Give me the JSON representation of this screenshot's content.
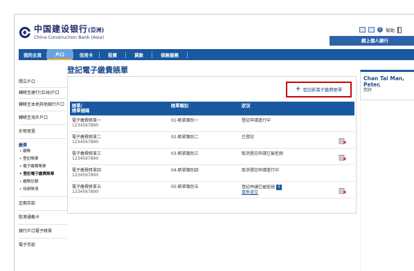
{
  "brand": {
    "name_zh": "中国建设银行",
    "name_zh_suffix": "(亞洲)",
    "name_en": "China Construction Bank (Asia)"
  },
  "utility": {
    "help_label": "幫助",
    "colors": {
      "accent": "#1a58a1",
      "highlight": "#c00000"
    }
  },
  "personal_banking_label": "網上個人銀行",
  "nav": [
    {
      "label": "我的主頁"
    },
    {
      "label": "戶口"
    },
    {
      "label": "信用卡"
    },
    {
      "label": "投資"
    },
    {
      "label": "貸款"
    },
    {
      "label": "保險服務"
    }
  ],
  "sidebar": {
    "items_top": [
      {
        "label": "開立戶口"
      },
      {
        "label": "轉賬至建行(亞洲)戶口"
      },
      {
        "label": "轉賬至本地其他銀行戶口"
      },
      {
        "label": "轉賬至海外戶口"
      },
      {
        "label": "外幣買賣"
      }
    ],
    "section_title": "繳費",
    "sub_items": [
      {
        "label": "繳賬"
      },
      {
        "label": "登記賬單"
      },
      {
        "label": "電子繳費賬單"
      },
      {
        "label": "登記電子繳費賬單"
      },
      {
        "label": "繳賬記錄"
      },
      {
        "label": "待辦賬項"
      }
    ],
    "items_bottom": [
      {
        "label": "定期存款"
      },
      {
        "label": "陸港通載卡"
      },
      {
        "label": "銀行戶口電子賬單"
      },
      {
        "label": "電子存款"
      }
    ]
  },
  "page_title": "登記電子繳費賬單",
  "add_button_label": "登記新電子繳費賬單",
  "table": {
    "headers": [
      "賬單/\n賬單號碼",
      "賬單類別",
      "狀況"
    ],
    "rows": [
      {
        "name": "電子繳費賬單一",
        "number": "1234567890",
        "category": "01-賬單類別一",
        "status": "登記申請進行中",
        "has_delete": false,
        "has_info": false,
        "link": ""
      },
      {
        "name": "電子繳費賬單二",
        "number": "1234567890",
        "category": "02-賬單類別二",
        "status": "已登記",
        "has_delete": true,
        "has_info": false,
        "link": ""
      },
      {
        "name": "電子繳費賬單三",
        "number": "1234567890",
        "category": "03-賬單類別三",
        "status": "取消登記申請已被拒絕",
        "has_delete": true,
        "has_info": false,
        "link": ""
      },
      {
        "name": "電子繳費賬單四",
        "number": "1234567890",
        "category": "04-賬單類別四",
        "status": "取消登記申請進行中",
        "has_delete": false,
        "has_info": false,
        "link": ""
      },
      {
        "name": "電子繳費賬單五",
        "number": "1234567890",
        "category": "05-賬單類別五",
        "status": "登記申請已被拒絕",
        "has_delete": true,
        "has_info": true,
        "link": "重新遞交"
      }
    ]
  },
  "user": {
    "name": "Chan Tai Man, Peter,",
    "greeting": "您好"
  }
}
